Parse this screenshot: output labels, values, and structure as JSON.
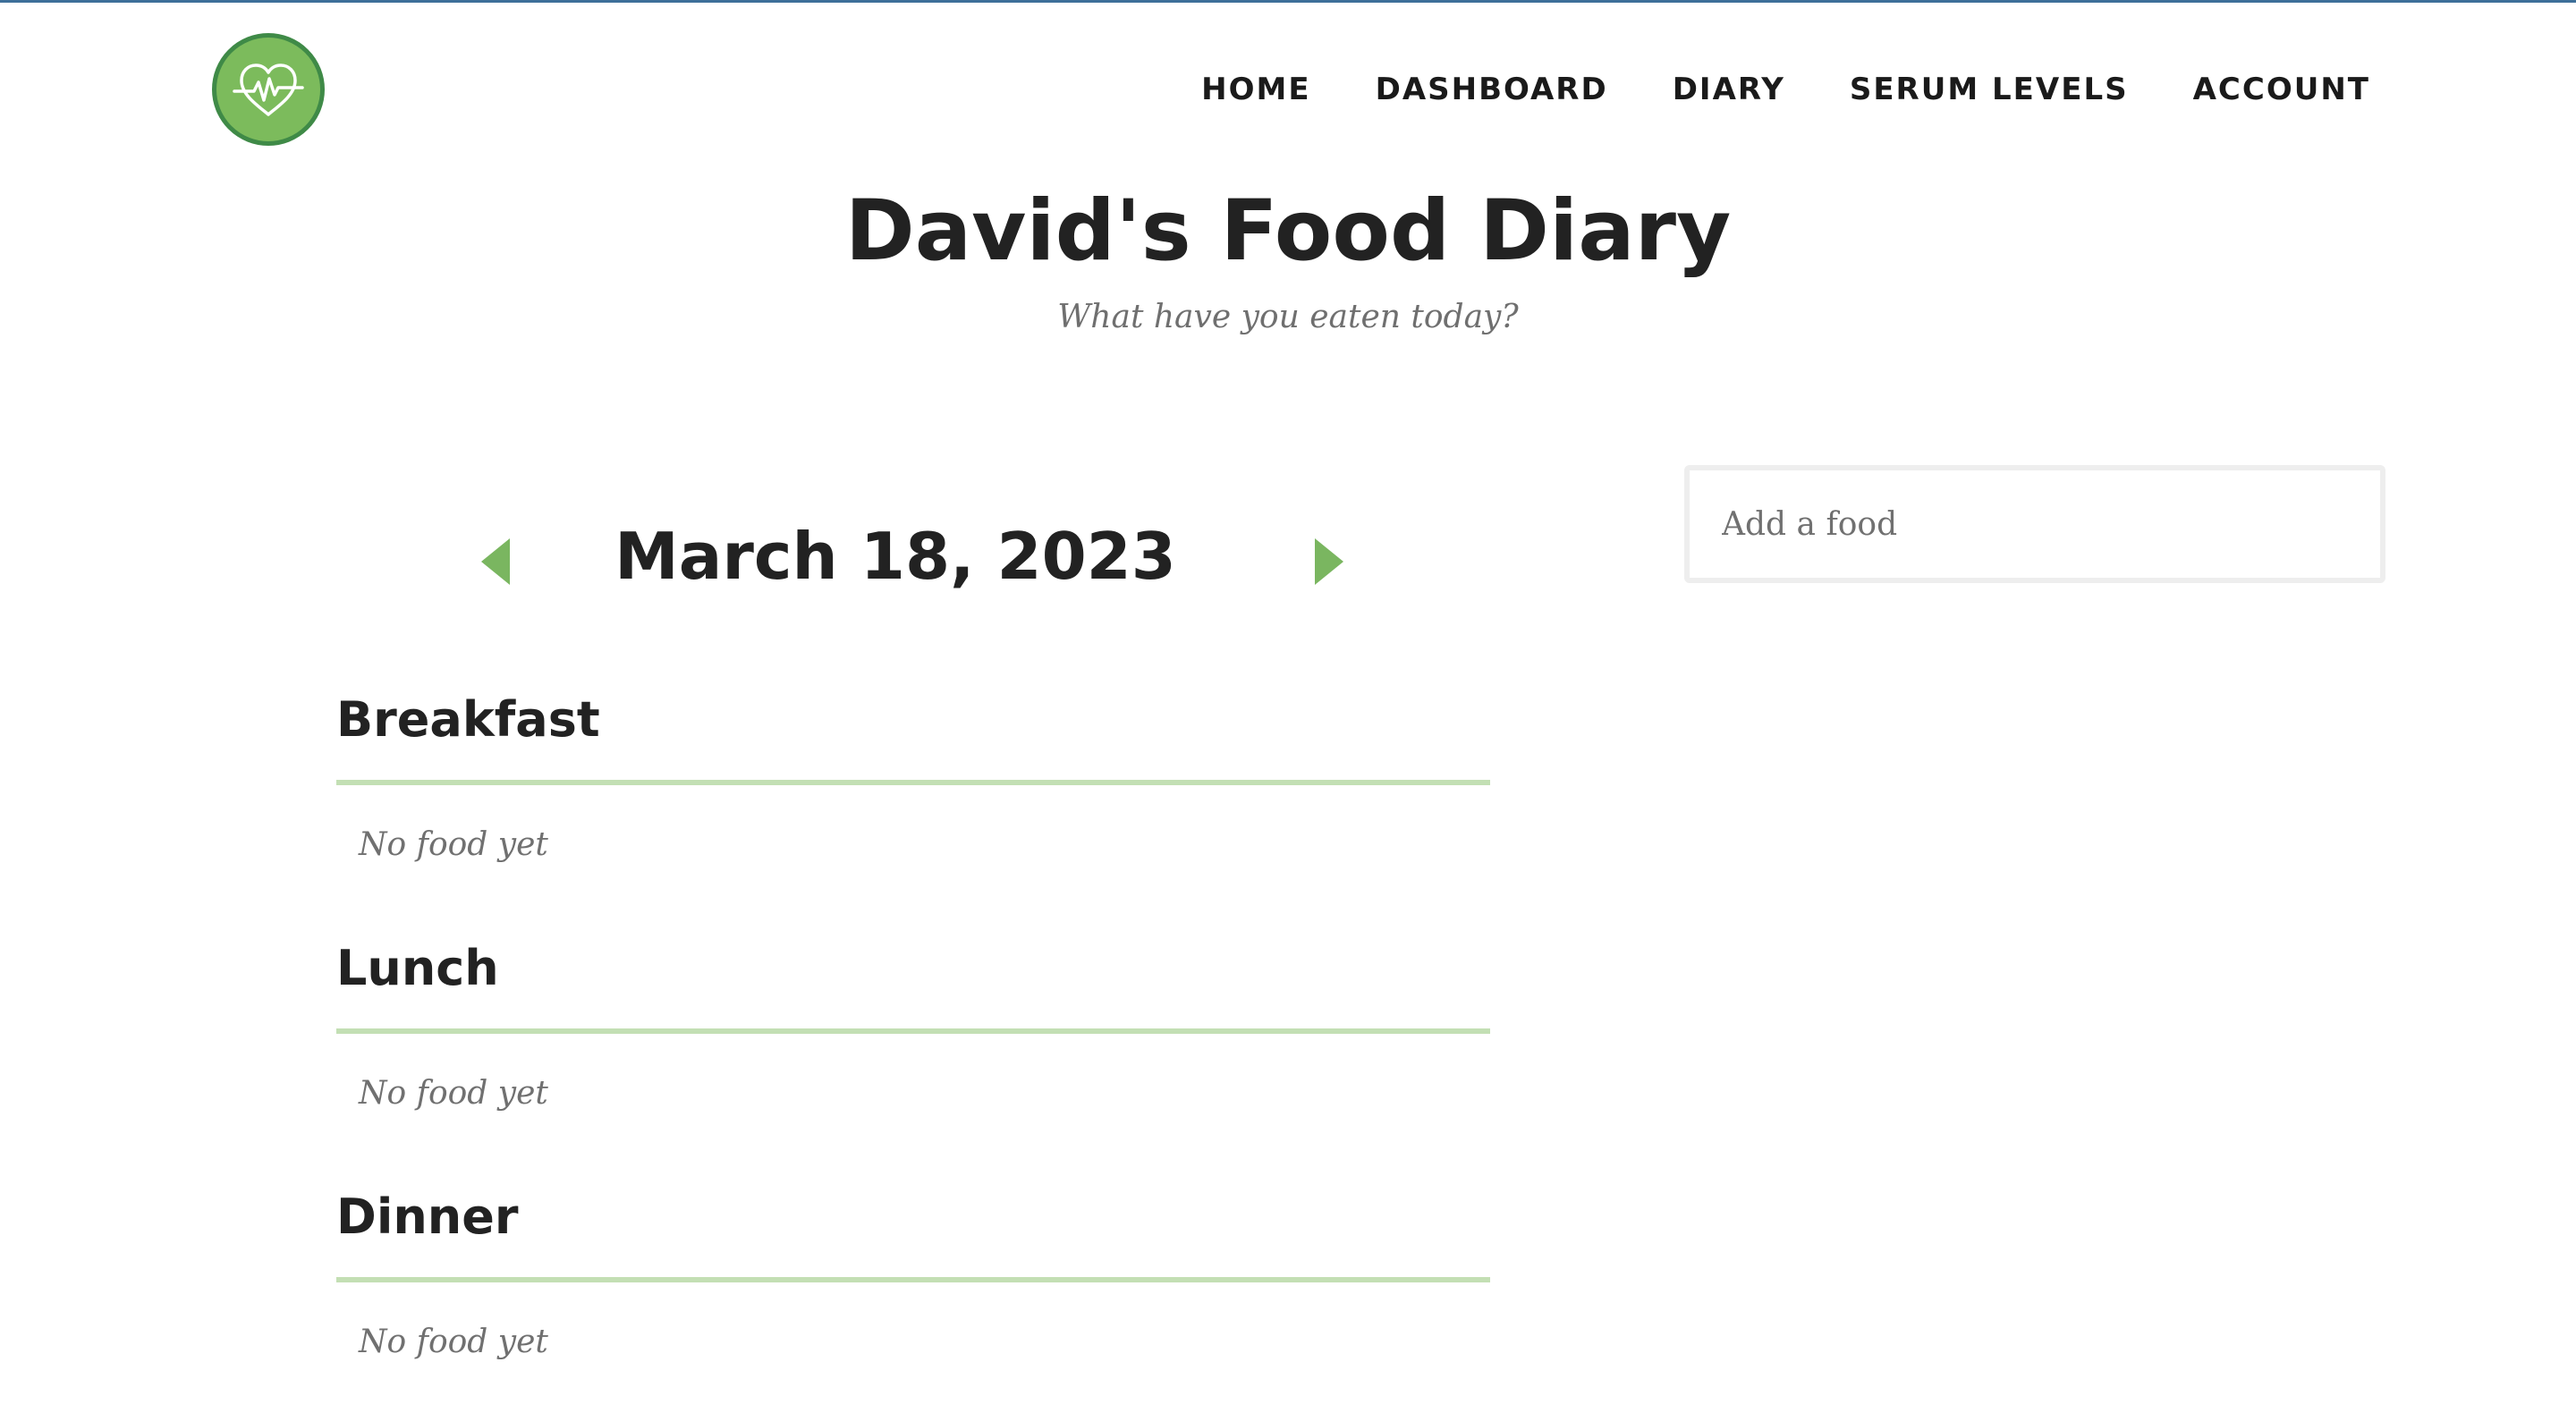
{
  "header": {
    "logo_icon": "heart-pulse-icon",
    "nav": [
      {
        "label": "HOME"
      },
      {
        "label": "DASHBOARD"
      },
      {
        "label": "DIARY"
      },
      {
        "label": "SERUM LEVELS"
      },
      {
        "label": "ACCOUNT"
      }
    ]
  },
  "page": {
    "title": "David's Food Diary",
    "subtitle": "What have you eaten today?"
  },
  "date_nav": {
    "date": "March 18, 2023",
    "prev_icon": "triangle-left-icon",
    "next_icon": "triangle-right-icon"
  },
  "meals": [
    {
      "name": "Breakfast",
      "empty_text": "No food yet"
    },
    {
      "name": "Lunch",
      "empty_text": "No food yet"
    },
    {
      "name": "Dinner",
      "empty_text": "No food yet"
    }
  ],
  "search": {
    "placeholder": "Add a food",
    "value": ""
  },
  "colors": {
    "accent_green": "#7cbb5c",
    "logo_border": "#3f8a47",
    "rule_green": "#c3dfb4",
    "top_line": "#3d6f99"
  }
}
